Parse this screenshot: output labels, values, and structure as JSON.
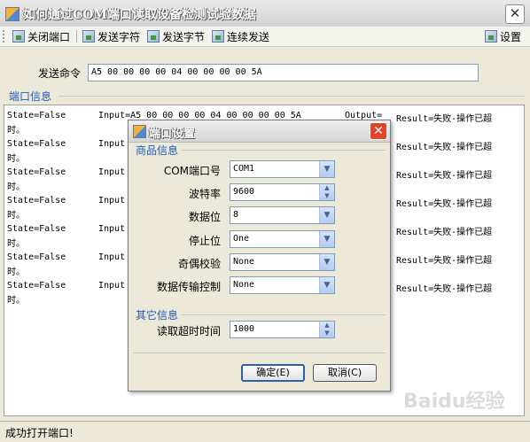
{
  "window": {
    "title": "如何通过COM端口读取设备检测试验数据"
  },
  "toolbar": {
    "close_port": "关闭端口",
    "send_char": "发送字符",
    "send_byte": "发送字节",
    "continuous_send": "连续发送",
    "settings": "设置"
  },
  "send": {
    "label": "发送命令",
    "value": "A5 00 00 00 00 04 00 00 00 00 5A"
  },
  "port_info": {
    "header": "端口信息"
  },
  "log_rows": [
    {
      "state": "State=False",
      "input": "Input=A5 00 00 00 00 04 00 00 00 00 5A",
      "output": "Output=",
      "result": "Result=失败-操作已超",
      "wrap": "时。"
    },
    {
      "state": "State=False",
      "input": "Input",
      "result": "Result=失败-操作已超",
      "wrap": "时。"
    },
    {
      "state": "State=False",
      "input": "Input",
      "result": "Result=失败-操作已超",
      "wrap": "时。"
    },
    {
      "state": "State=False",
      "input": "Input",
      "result": "Result=失败-操作已超",
      "wrap": "时。"
    },
    {
      "state": "State=False",
      "input": "Input",
      "result": "Result=失败-操作已超",
      "wrap": "时。"
    },
    {
      "state": "State=False",
      "input": "Input",
      "result": "Result=失败-操作已超",
      "wrap": "时。"
    },
    {
      "state": "State=False",
      "input": "Input",
      "result": "Result=失败-操作已超",
      "wrap": "时。"
    }
  ],
  "status": {
    "text": "成功打开端口!"
  },
  "dialog": {
    "title": "端口设置",
    "group1": "商品信息",
    "group2": "其它信息",
    "fields": {
      "com_label": "COM端口号",
      "com_value": "COM1",
      "baud_label": "波特率",
      "baud_value": "9600",
      "data_label": "数据位",
      "data_value": "8",
      "stop_label": "停止位",
      "stop_value": "One",
      "parity_label": "奇偶校验",
      "parity_value": "None",
      "flow_label": "数据传输控制",
      "flow_value": "None",
      "timeout_label": "读取超时时间",
      "timeout_value": "1000"
    },
    "ok": "确定(E)",
    "cancel": "取消(C)"
  },
  "watermark": "Baidu经验"
}
